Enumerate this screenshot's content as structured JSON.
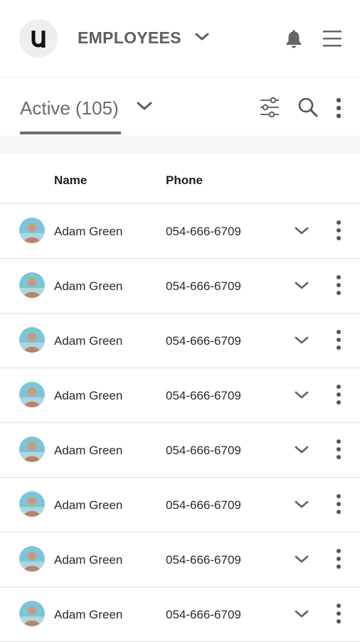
{
  "header": {
    "logo_letter": "U",
    "title": "EMPLOYEES",
    "icons": [
      "chevron-down-icon",
      "bell-icon",
      "hamburger-menu-icon"
    ]
  },
  "filter_bar": {
    "status_label": "Active (105)",
    "icons": [
      "chevron-down-icon",
      "filter-sliders-icon",
      "search-icon",
      "more-vertical-icon"
    ]
  },
  "table": {
    "columns": [
      "Name",
      "Phone"
    ],
    "rows": [
      {
        "name": "Adam Green",
        "phone": "054-666-6709"
      },
      {
        "name": "Adam Green",
        "phone": "054-666-6709"
      },
      {
        "name": "Adam Green",
        "phone": "054-666-6709"
      },
      {
        "name": "Adam Green",
        "phone": "054-666-6709"
      },
      {
        "name": "Adam Green",
        "phone": "054-666-6709"
      },
      {
        "name": "Adam Green",
        "phone": "054-666-6709"
      },
      {
        "name": "Adam Green",
        "phone": "054-666-6709"
      },
      {
        "name": "Adam Green",
        "phone": "054-666-6709"
      }
    ]
  },
  "colors": {
    "accent_gray": "#6d6d6d",
    "divider": "#dedede",
    "avatar_bg": "#7fc4d6"
  }
}
